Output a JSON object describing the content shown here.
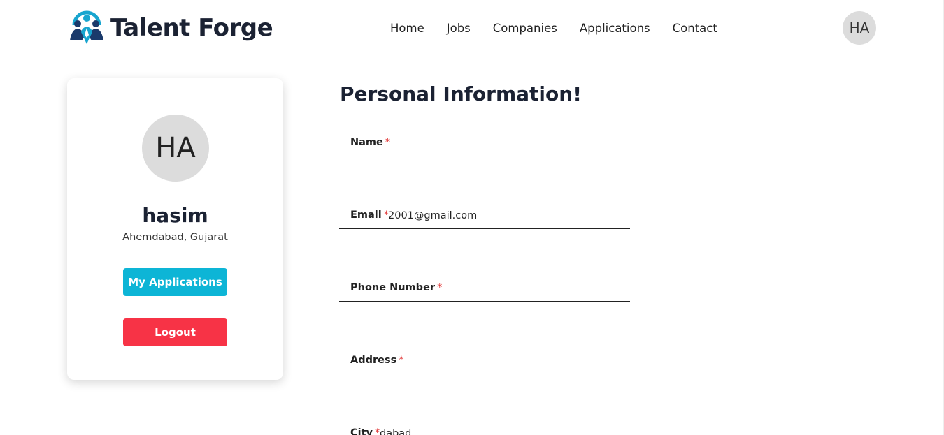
{
  "brand": {
    "name": "Talent Forge",
    "logo_icon": "people-network-logo",
    "colors": {
      "navy": "#1b3a6b",
      "teal": "#18a5cf"
    }
  },
  "nav": [
    {
      "label": "Home"
    },
    {
      "label": "Jobs"
    },
    {
      "label": "Companies"
    },
    {
      "label": "Applications"
    },
    {
      "label": "Contact"
    }
  ],
  "user_avatar_initials": "HA",
  "profile": {
    "initials": "HA",
    "username": "hasim",
    "location": "Ahemdabad, Gujarat",
    "my_applications_label": "My Applications",
    "logout_label": "Logout",
    "colors": {
      "applications_button": "#0db5d6",
      "logout_button": "#f73346"
    }
  },
  "form": {
    "title": "Personal Information!",
    "required_marker": "*",
    "fields": [
      {
        "label": "Name",
        "value": ""
      },
      {
        "label": "Email",
        "value": "2001@gmail.com"
      },
      {
        "label": "Phone Number",
        "value": ""
      },
      {
        "label": "Address",
        "value": ""
      },
      {
        "label": "City",
        "value": "dabad"
      }
    ]
  }
}
